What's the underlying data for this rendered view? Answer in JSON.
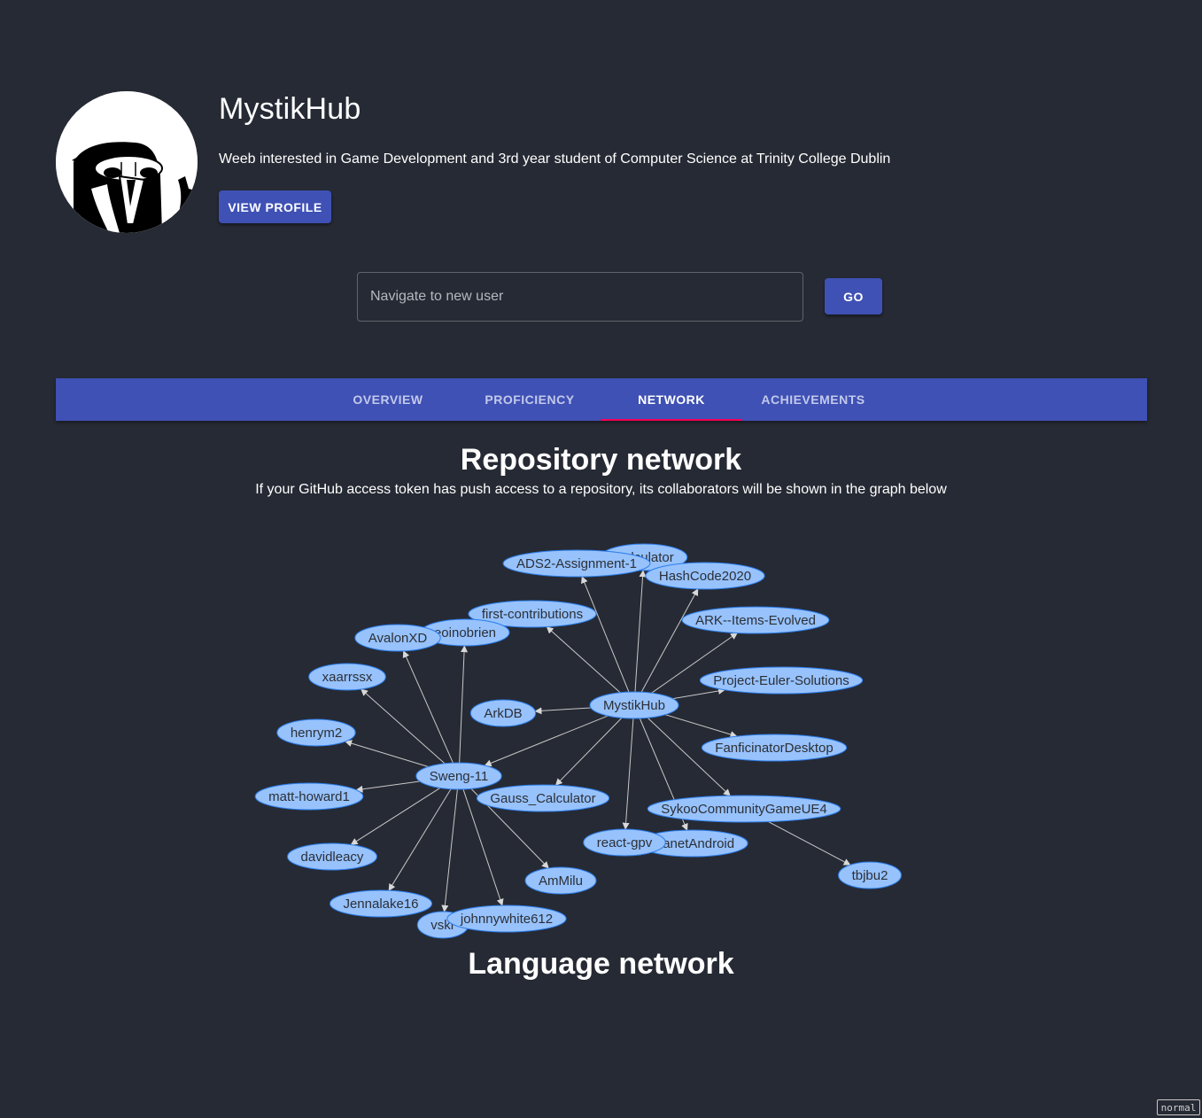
{
  "user": {
    "name": "MystikHub",
    "bio": "Weeb interested in Game Development and 3rd year student of Computer Science at Trinity College Dublin",
    "avatar_icon": "owl-avatar-icon",
    "view_profile_label": "VIEW PROFILE"
  },
  "navigate": {
    "placeholder": "Navigate to new user",
    "value": "",
    "go_label": "GO"
  },
  "tabs": [
    {
      "label": "OVERVIEW",
      "active": false
    },
    {
      "label": "PROFICIENCY",
      "active": false
    },
    {
      "label": "NETWORK",
      "active": true
    },
    {
      "label": "ACHIEVEMENTS",
      "active": false
    }
  ],
  "colors": {
    "background": "#262a34",
    "primary": "#3f51b5",
    "tab_indicator": "#f50057",
    "node_fill": "#97c2fc",
    "node_border": "#2b7ce9",
    "edge": "#c8c8c8"
  },
  "repository_network": {
    "title": "Repository network",
    "subtitle": "If your GitHub access token has push access to a repository, its collaborators will be shown in the graph below",
    "nodes": [
      {
        "id": "calc",
        "label": "Calculator"
      },
      {
        "id": "ads2",
        "label": "ADS2-Assignment-1"
      },
      {
        "id": "hash",
        "label": "HashCode2020"
      },
      {
        "id": "first",
        "label": "first-contributions"
      },
      {
        "id": "ark",
        "label": "ARK--Items-Evolved"
      },
      {
        "id": "eoin",
        "label": "eoinobrien"
      },
      {
        "id": "avalon",
        "label": "AvalonXD"
      },
      {
        "id": "xaar",
        "label": "xaarrssx"
      },
      {
        "id": "euler",
        "label": "Project-Euler-Solutions"
      },
      {
        "id": "mystik",
        "label": "MystikHub"
      },
      {
        "id": "arkdb",
        "label": "ArkDB"
      },
      {
        "id": "henry",
        "label": "henrym2"
      },
      {
        "id": "fanfic",
        "label": "FanficinatorDesktop"
      },
      {
        "id": "sweng",
        "label": "Sweng-11"
      },
      {
        "id": "matt",
        "label": "matt-howard1"
      },
      {
        "id": "gauss",
        "label": "Gauss_Calculator"
      },
      {
        "id": "sykoo",
        "label": "SykooCommunityGameUE4"
      },
      {
        "id": "planet",
        "label": "PlanetAndroid"
      },
      {
        "id": "react",
        "label": "react-gpv"
      },
      {
        "id": "david",
        "label": "davidleacy"
      },
      {
        "id": "tbj",
        "label": "tbjbu2"
      },
      {
        "id": "ammilu",
        "label": "AmMilu"
      },
      {
        "id": "jenna",
        "label": "Jennalake16"
      },
      {
        "id": "vskr",
        "label": "vskr"
      },
      {
        "id": "johnny",
        "label": "johnnywhite612"
      }
    ],
    "edges": [
      [
        "mystik",
        "ads2"
      ],
      [
        "mystik",
        "calc"
      ],
      [
        "mystik",
        "hash"
      ],
      [
        "mystik",
        "first"
      ],
      [
        "mystik",
        "ark"
      ],
      [
        "mystik",
        "euler"
      ],
      [
        "mystik",
        "arkdb"
      ],
      [
        "mystik",
        "fanfic"
      ],
      [
        "mystik",
        "sweng"
      ],
      [
        "mystik",
        "gauss"
      ],
      [
        "mystik",
        "sykoo"
      ],
      [
        "mystik",
        "planet"
      ],
      [
        "mystik",
        "react"
      ],
      [
        "sweng",
        "avalon"
      ],
      [
        "sweng",
        "eoin"
      ],
      [
        "sweng",
        "xaar"
      ],
      [
        "sweng",
        "henry"
      ],
      [
        "sweng",
        "matt"
      ],
      [
        "sweng",
        "david"
      ],
      [
        "sweng",
        "jenna"
      ],
      [
        "sweng",
        "vskr"
      ],
      [
        "sweng",
        "johnny"
      ],
      [
        "sweng",
        "ammilu"
      ],
      [
        "sykoo",
        "tbj"
      ]
    ]
  },
  "language_network": {
    "title": "Language network"
  },
  "mode_badge": "normal"
}
